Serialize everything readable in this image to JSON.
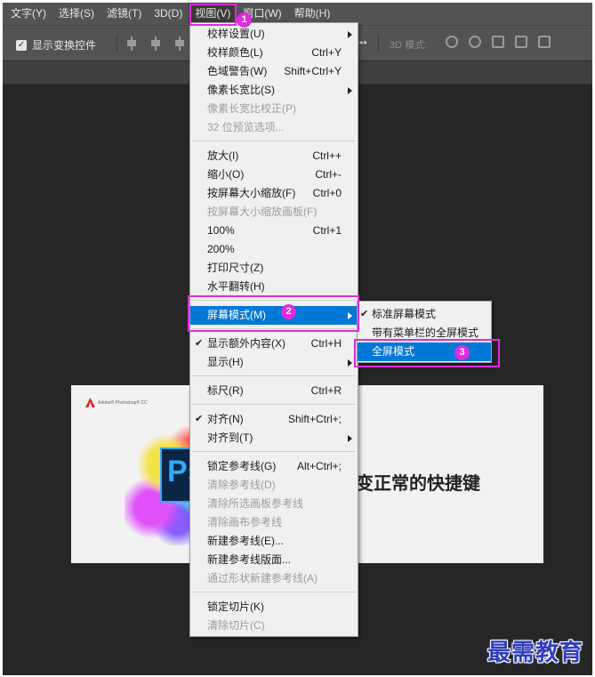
{
  "menubar": {
    "items": [
      {
        "label": "文字(Y)"
      },
      {
        "label": "选择(S)"
      },
      {
        "label": "滤镜(T)"
      },
      {
        "label": "3D(D)"
      },
      {
        "label": "视图(V)"
      },
      {
        "label": "窗口(W)"
      },
      {
        "label": "帮助(H)"
      }
    ],
    "active_index": 4
  },
  "options_bar": {
    "show_transform_controls": "显示变换控件",
    "checked": true,
    "more": "•••",
    "mode_3d": "3D 模式:"
  },
  "document": {
    "brand": "Adobe® Photoshop® CC",
    "ps_letter": "Ps",
    "title_fragment": "变正常的快捷键"
  },
  "view_menu": {
    "items": [
      {
        "label": "校样设置(U)",
        "shortcut": "",
        "submenu": true,
        "disabled": false
      },
      {
        "label": "校样颜色(L)",
        "shortcut": "Ctrl+Y",
        "disabled": false
      },
      {
        "label": "色域警告(W)",
        "shortcut": "Shift+Ctrl+Y",
        "disabled": false
      },
      {
        "label": "像素长宽比(S)",
        "shortcut": "",
        "submenu": true,
        "disabled": false
      },
      {
        "label": "像素长宽比校正(P)",
        "shortcut": "",
        "disabled": true
      },
      {
        "label": "32 位预览选项...",
        "shortcut": "",
        "disabled": true
      },
      {
        "label": "放大(I)",
        "shortcut": "Ctrl++",
        "disabled": false
      },
      {
        "label": "缩小(O)",
        "shortcut": "Ctrl+-",
        "disabled": false
      },
      {
        "label": "按屏幕大小缩放(F)",
        "shortcut": "Ctrl+0",
        "disabled": false
      },
      {
        "label": "按屏幕大小缩放画板(F)",
        "shortcut": "",
        "disabled": true
      },
      {
        "label": "100%",
        "shortcut": "Ctrl+1",
        "disabled": false
      },
      {
        "label": "200%",
        "shortcut": "",
        "disabled": false
      },
      {
        "label": "打印尺寸(Z)",
        "shortcut": "",
        "disabled": false
      },
      {
        "label": "水平翻转(H)",
        "shortcut": "",
        "disabled": false
      },
      {
        "label": "屏幕模式(M)",
        "shortcut": "",
        "submenu": true,
        "highlighted": true
      },
      {
        "label": "显示额外内容(X)",
        "shortcut": "Ctrl+H",
        "checked": true
      },
      {
        "label": "显示(H)",
        "shortcut": "",
        "submenu": true
      },
      {
        "label": "标尺(R)",
        "shortcut": "Ctrl+R"
      },
      {
        "label": "对齐(N)",
        "shortcut": "Shift+Ctrl+;",
        "checked": true
      },
      {
        "label": "对齐到(T)",
        "shortcut": "",
        "submenu": true
      },
      {
        "label": "锁定参考线(G)",
        "shortcut": "Alt+Ctrl+;"
      },
      {
        "label": "清除参考线(D)",
        "shortcut": "",
        "disabled": true
      },
      {
        "label": "清除所选画板参考线",
        "shortcut": "",
        "disabled": true
      },
      {
        "label": "清除画布参考线",
        "shortcut": "",
        "disabled": true
      },
      {
        "label": "新建参考线(E)...",
        "shortcut": ""
      },
      {
        "label": "新建参考线版面...",
        "shortcut": ""
      },
      {
        "label": "通过形状新建参考线(A)",
        "shortcut": "",
        "disabled": true
      },
      {
        "label": "锁定切片(K)",
        "shortcut": ""
      },
      {
        "label": "清除切片(C)",
        "shortcut": "",
        "disabled": true
      }
    ]
  },
  "screen_mode_submenu": {
    "items": [
      {
        "label": "标准屏幕模式",
        "checked": true
      },
      {
        "label": "带有菜单栏的全屏模式"
      },
      {
        "label": "全屏模式",
        "highlighted": true
      }
    ]
  },
  "annotations": {
    "step1": "1",
    "step2": "2",
    "step3": "3",
    "color": "#e02be0"
  },
  "watermark": "最需教育",
  "colors": {
    "highlight": "#0078d7",
    "annotation": "#e02be0",
    "app_bg": "#262626",
    "menubar_bg": "#535353"
  }
}
